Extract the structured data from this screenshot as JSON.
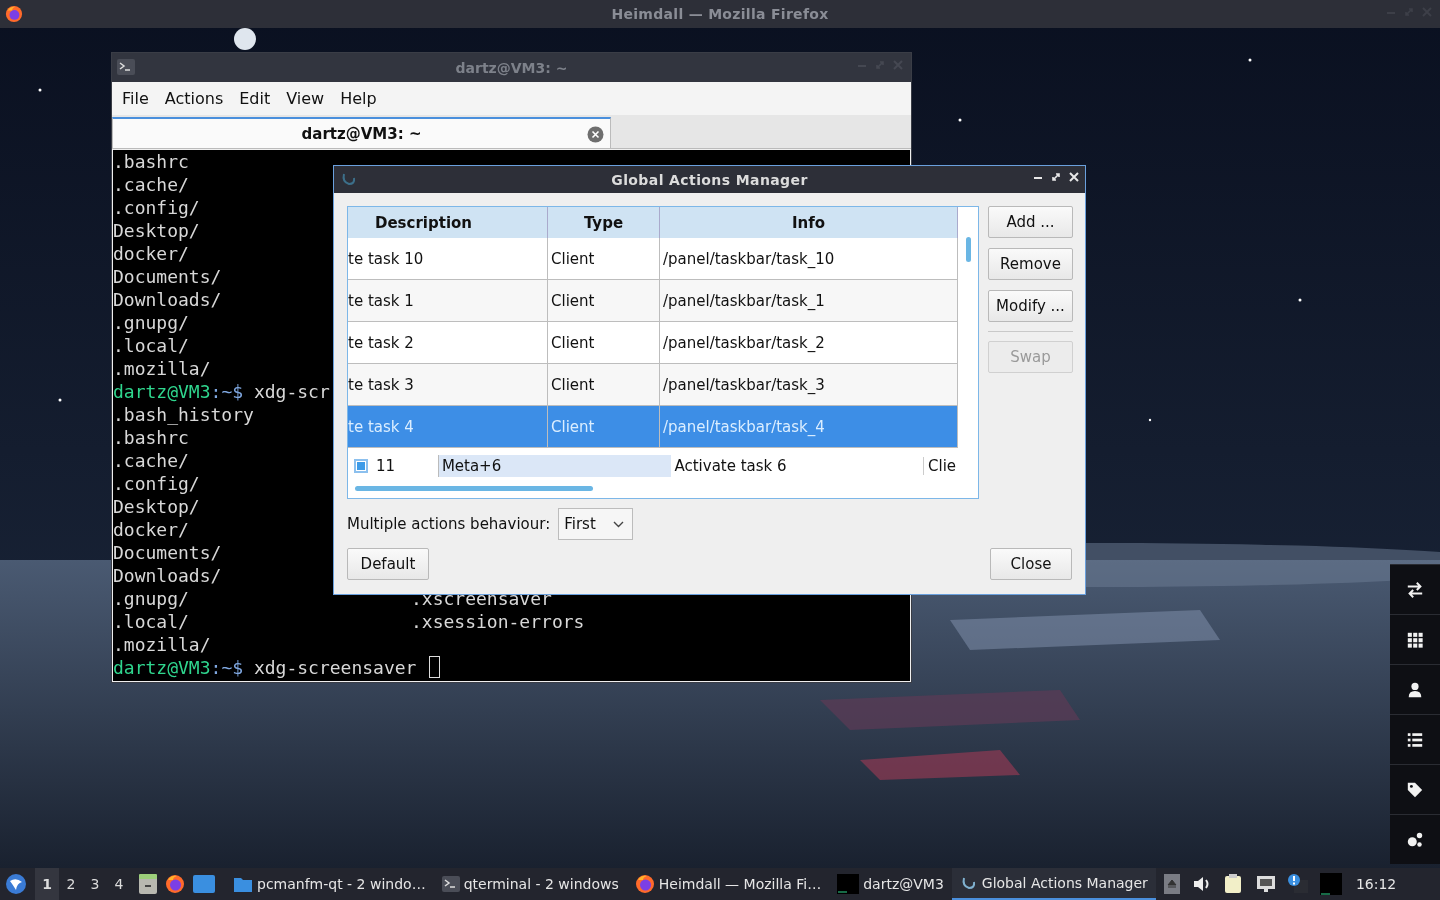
{
  "browser_bar": {
    "title": "Heimdall — Mozilla Firefox"
  },
  "terminal": {
    "title": "dartz@VM3: ~",
    "menu": [
      "File",
      "Actions",
      "Edit",
      "View",
      "Help"
    ],
    "tabs": [
      {
        "label": "dartz@VM3: ~",
        "selected": true
      }
    ],
    "lines": [
      {
        "kind": "output",
        "text": ".bashrc"
      },
      {
        "kind": "output",
        "text": ".cache/"
      },
      {
        "kind": "output",
        "text": ".config/"
      },
      {
        "kind": "output",
        "text": "Desktop/"
      },
      {
        "kind": "output",
        "text": "docker/"
      },
      {
        "kind": "output",
        "text": "Documents/"
      },
      {
        "kind": "output",
        "text": "Downloads/"
      },
      {
        "kind": "output",
        "text": ".gnupg/"
      },
      {
        "kind": "output",
        "text": ".local/"
      },
      {
        "kind": "output",
        "text": ".mozilla/"
      },
      {
        "kind": "prompt",
        "user": "dartz@VM3",
        "path": ":~$",
        "command": "xdg-scr",
        "cursor": false
      },
      {
        "kind": "output",
        "text": ".bash_history"
      },
      {
        "kind": "output",
        "text": ".bashrc"
      },
      {
        "kind": "output",
        "text": ".cache/"
      },
      {
        "kind": "output",
        "text": ".config/"
      },
      {
        "kind": "output",
        "text": "Desktop/"
      },
      {
        "kind": "output",
        "text": "docker/"
      },
      {
        "kind": "output",
        "text": "Documents/"
      },
      {
        "kind": "output",
        "text": "Downloads/"
      },
      {
        "kind": "output",
        "text": ".gnupg/",
        "column_2": ".xscreensaver"
      },
      {
        "kind": "output",
        "text": ".local/",
        "column_2": ".xsession-errors"
      },
      {
        "kind": "output",
        "text": ".mozilla/"
      },
      {
        "kind": "prompt",
        "user": "dartz@VM3",
        "path": ":~$",
        "command": "xdg-screensaver",
        "cursor": true
      }
    ]
  },
  "dialog": {
    "title": "Global Actions Manager",
    "columns": [
      "Description",
      "Type",
      "Info"
    ],
    "rows": [
      {
        "description": "te task 10",
        "type": "Client",
        "info": "/panel/taskbar/task_10",
        "selected": false
      },
      {
        "description": "te task 1",
        "type": "Client",
        "info": "/panel/taskbar/task_1",
        "selected": false
      },
      {
        "description": "te task 2",
        "type": "Client",
        "info": "/panel/taskbar/task_2",
        "selected": false
      },
      {
        "description": "te task 3",
        "type": "Client",
        "info": "/panel/taskbar/task_3",
        "selected": false
      },
      {
        "description": "te task 4",
        "type": "Client",
        "info": "/panel/taskbar/task_4",
        "selected": true
      }
    ],
    "editor_row": {
      "checked": true,
      "id": "11",
      "shortcut": "Meta+6",
      "description": "Activate task 6",
      "type": "Clie"
    },
    "buttons": [
      {
        "label": "Add ...",
        "disabled": false
      },
      {
        "label": "Remove",
        "disabled": false
      },
      {
        "label": "Modify ...",
        "disabled": false
      },
      {
        "label": "Swap",
        "disabled": true
      }
    ],
    "behaviour": {
      "label": "Multiple actions behaviour:",
      "value": "First"
    },
    "default_button": "Default",
    "close_button": "Close"
  },
  "taskbar": {
    "desktops": [
      {
        "label": "1",
        "selected": true
      },
      {
        "label": "2",
        "selected": false
      },
      {
        "label": "3",
        "selected": false
      },
      {
        "label": "4",
        "selected": false
      }
    ],
    "tasks": [
      {
        "kind": "folder",
        "label": "pcmanfm-qt - 2 windo…",
        "active": false
      },
      {
        "kind": "terminal",
        "label": "qterminal - 2 windows",
        "active": false
      },
      {
        "kind": "browser",
        "label": "Heimdall — Mozilla Fi…",
        "active": false
      },
      {
        "kind": "screen",
        "label": "dartz@VM3",
        "active": false
      },
      {
        "kind": "swirl",
        "label": "Global Actions Manager",
        "active": true
      }
    ],
    "clock": "16:12"
  }
}
